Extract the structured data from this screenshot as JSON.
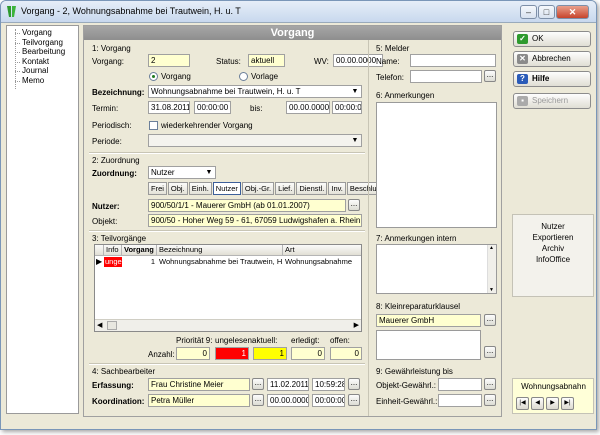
{
  "window": {
    "title": "Vorgang - 2, Wohnungsabnahme bei Trautwein, H. u. T"
  },
  "tree": {
    "items": [
      "Vorgang",
      "Teilvorgang",
      "Bearbeitung",
      "Kontakt",
      "Journal",
      "Memo"
    ]
  },
  "header": {
    "title": "Vorgang"
  },
  "vorgang": {
    "section": "1: Vorgang",
    "vorgang_label": "Vorgang:",
    "vorgang_value": "2",
    "status_label": "Status:",
    "status_value": "aktuell",
    "wv_label": "WV:",
    "wv_value": "00.00.0000",
    "radio_vorgang": "Vorgang",
    "radio_vorlage": "Vorlage",
    "bezeichnung_label": "Bezeichnung:",
    "bezeichnung_value": "Wohnungsabnahme bei Trautwein, H. u. T",
    "termin_label": "Termin:",
    "termin_date": "31.08.2011",
    "termin_time": "00:00:00",
    "bis_label": "bis:",
    "bis_date": "00.00.0000",
    "bis_time": "00:00:00",
    "periodisch_label": "Periodisch:",
    "periodisch_check": "wiederkehrender Vorgang",
    "periode_label": "Periode:",
    "periode_value": ""
  },
  "zuordnung": {
    "section": "2: Zuordnung",
    "label": "Zuordnung:",
    "value": "Nutzer",
    "tabs": [
      "Frei",
      "Obj.",
      "Einh.",
      "Nutzer",
      "Obj.-Gr.",
      "Lief.",
      "Dienstl.",
      "Inv.",
      "Beschluss"
    ],
    "active_tab": "Nutzer",
    "nutzer_label": "Nutzer:",
    "nutzer_value": "900/50/1/1 - Mauerer GmbH  (ab 01.01.2007)",
    "objekt_label": "Objekt:",
    "objekt_value": "900/50 - Hoher Weg 59 - 61, 67059 Ludwigshafen a. Rhein"
  },
  "teilvorgaenge": {
    "section": "3: Teilvorgänge",
    "columns": [
      "Info",
      "Vorgang",
      "Bezeichnung",
      "Art"
    ],
    "rows": [
      {
        "info": "unge",
        "vorgang": "1",
        "bezeichnung": "Wohnungsabnahme bei Trautwein, H. u",
        "art": "Wohnungsabnahme"
      }
    ],
    "prioritaet_label": "Priorität 9:",
    "ungelesen_label": "ungelesen:",
    "aktuell_label": "aktuell:",
    "erledigt_label": "erledigt:",
    "offen_label": "offen:",
    "anzahl_label": "Anzahl:",
    "counts": {
      "prioritaet": "0",
      "ungelesen": "1",
      "aktuell": "1",
      "erledigt": "0",
      "offen": "0"
    }
  },
  "sachbearbeiter": {
    "section": "4: Sachbearbeiter",
    "erfassung_label": "Erfassung:",
    "erfassung_name": "Frau Christine Meier",
    "erfassung_date": "11.02.2011",
    "erfassung_time": "10:59:28",
    "koordination_label": "Koordination:",
    "koordination_name": "Petra Müller",
    "koordination_date": "00.00.0000",
    "koordination_time": "00:00:00"
  },
  "melder": {
    "section": "5: Melder",
    "name_label": "Name:",
    "name_value": "",
    "telefon_label": "Telefon:",
    "telefon_value": ""
  },
  "anmerkungen": {
    "section": "6: Anmerkungen"
  },
  "anmerkungen_intern": {
    "section": "7: Anmerkungen intern"
  },
  "kleinreparatur": {
    "section": "8: Kleinreparaturklausel",
    "value": "Mauerer GmbH"
  },
  "gewaehrleistung": {
    "section": "9: Gewährleistung bis",
    "objekt_label": "Objekt-Gewährl.:",
    "einheit_label": "Einheit-Gewährl.:"
  },
  "buttons": {
    "ok": "OK",
    "abbrechen": "Abbrechen",
    "hilfe": "Hilfe",
    "speichern": "Speichern"
  },
  "links": [
    "Nutzer",
    "Exportieren",
    "Archiv",
    "InfoOffice"
  ],
  "navigator": {
    "label": "Wohnungsabnahn"
  },
  "colors": {
    "header_bg": "#999999",
    "yellow_field": "#ffffd0",
    "unread_red": "#ff0000",
    "aktuell_yellow": "#ffff00"
  }
}
